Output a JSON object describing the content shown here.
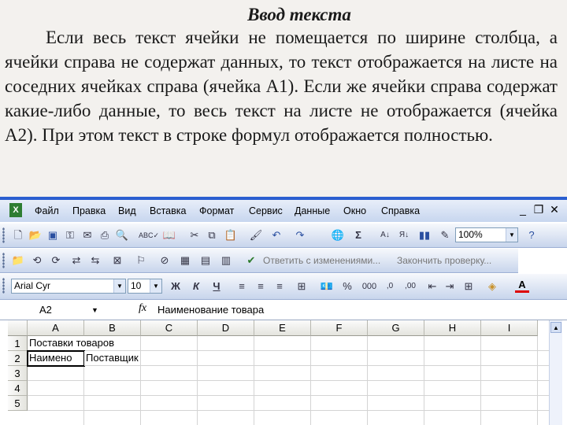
{
  "slide": {
    "title": "Ввод текста",
    "paragraph": "Если весь текст ячейки не помещается по ширине столбца, а ячейки справа не содержат данных, то текст отображается на листе на соседних ячейках справа (ячейка А1). Если же ячейки справа содержат какие-либо данные, то весь текст на листе не отображается (ячейка А2). При этом текст в строке формул отображается полностью."
  },
  "menu": {
    "items": [
      "Файл",
      "Правка",
      "Вид",
      "Вставка",
      "Формат",
      "Сервис",
      "Данные",
      "Окно",
      "Справка"
    ],
    "minimize": "_",
    "restore": "❐",
    "close": "✕"
  },
  "toolbar1": {
    "zoom": "100%"
  },
  "toolbar2": {
    "reply_changes": "Ответить с изменениями...",
    "end_review": "Закончить проверку..."
  },
  "toolbar3": {
    "font": "Arial Cyr",
    "size": "10",
    "bold": "Ж",
    "italic": "К",
    "underline": "Ч",
    "percent": "%",
    "thousands": "000",
    "font_color_letter": "A"
  },
  "formula_bar": {
    "name_box": "А2",
    "fx": "fx",
    "content": "Наименование товара"
  },
  "sheet": {
    "columns": [
      "A",
      "B",
      "C",
      "D",
      "E",
      "F",
      "G",
      "H",
      "I"
    ],
    "rows": [
      "1",
      "2",
      "3",
      "4",
      "5"
    ],
    "a1": "Поставки товаров",
    "a2": "Наимено",
    "b2": "Поставщик"
  },
  "colors": {
    "menubar_accent": "#2b5fd0",
    "toolbar_gradient_top": "#f6f8fc",
    "toolbar_gradient_bottom": "#c8d5ec"
  },
  "icons": [
    "excel-doc-icon",
    "new-icon",
    "open-icon",
    "save-icon",
    "print-icon",
    "spell-icon",
    "cut-icon",
    "copy-icon",
    "paste-icon",
    "undo-icon",
    "redo-icon",
    "sum-icon",
    "sort-icon",
    "chart-icon",
    "help-icon",
    "align-left-icon",
    "center-icon",
    "align-right-icon",
    "merge-icon",
    "currency-icon",
    "borders-icon",
    "fill-color-icon",
    "font-color-icon"
  ]
}
